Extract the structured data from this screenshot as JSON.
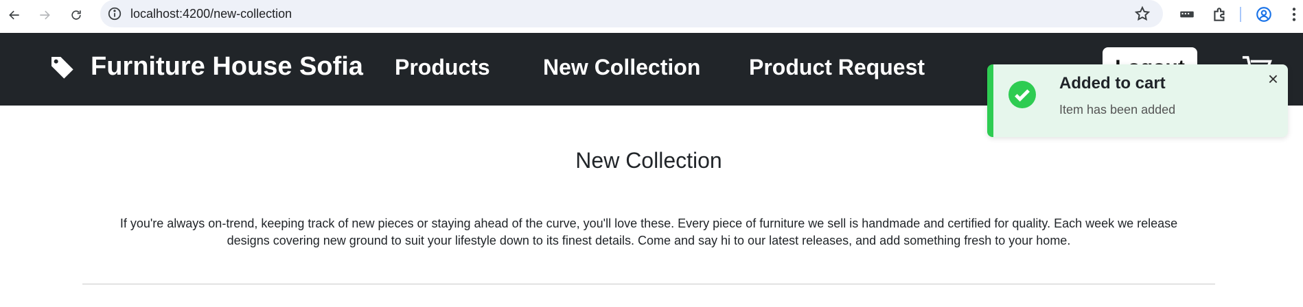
{
  "browser": {
    "url": "localhost:4200/new-collection"
  },
  "navbar": {
    "brand": "Furniture House Sofia",
    "links": [
      "Products",
      "New Collection",
      "Product Request"
    ],
    "logout_label": "Logout"
  },
  "toast": {
    "title": "Added to cart",
    "message": "Item has been added",
    "close_label": "×"
  },
  "main": {
    "title": "New Collection",
    "description_line1": "If you're always on-trend, keeping track of new pieces or staying ahead of the curve, you'll love these. Every piece of furniture we sell is handmade and certified for quality. Each week we release",
    "description_line2": "designs covering new ground to suit your lifestyle down to its finest details. Come and say hi to our latest releases, and add something fresh to your home."
  },
  "colors": {
    "navbar_bg": "#212529",
    "toast_bg": "#e6f6ec",
    "toast_accent": "#2ecc52"
  }
}
